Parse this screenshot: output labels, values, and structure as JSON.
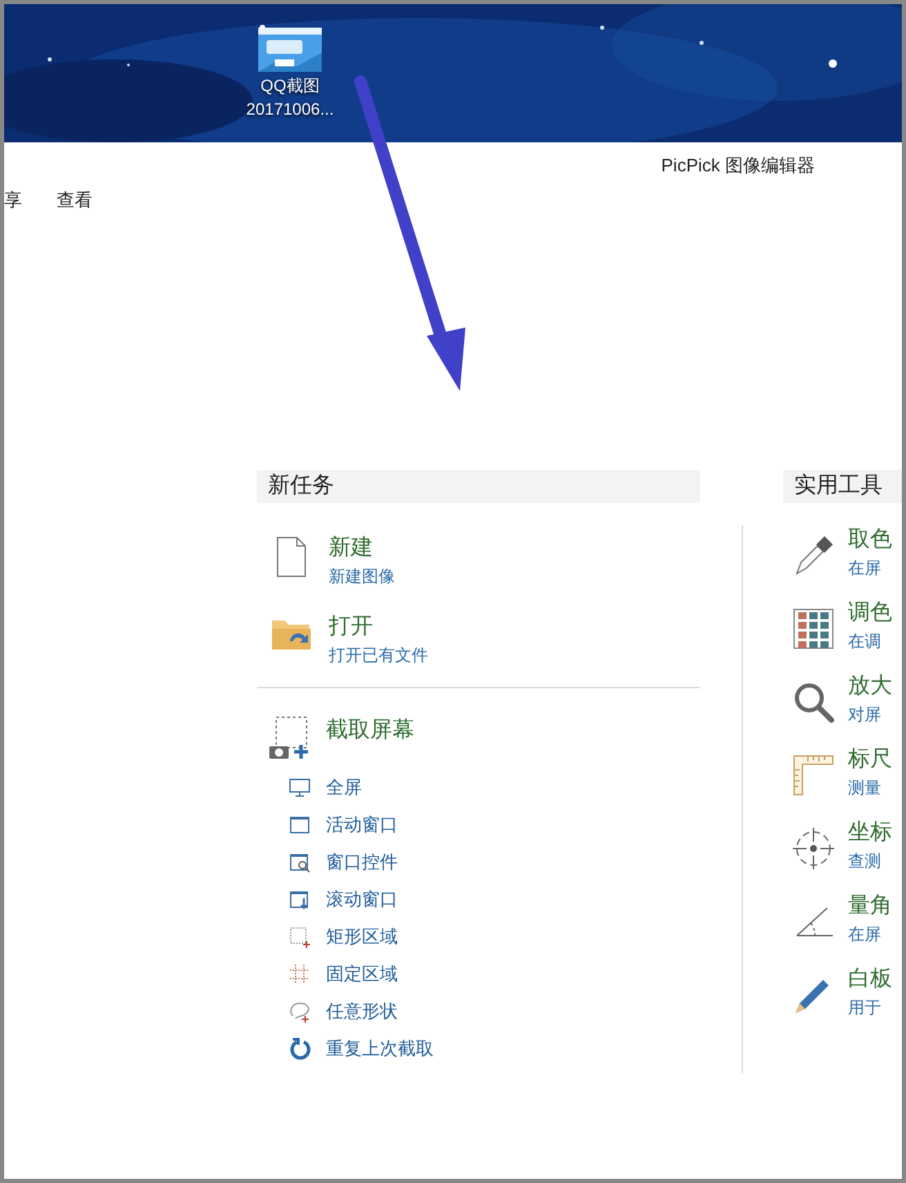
{
  "desktop": {
    "icon_label": "QQ截图\n20171006..."
  },
  "app": {
    "title": "PicPick 图像编辑器",
    "menu": [
      "享",
      "查看"
    ]
  },
  "new_task": {
    "title": "新任务",
    "items": [
      {
        "kind": "new",
        "title": "新建",
        "subtitle": "新建图像"
      },
      {
        "kind": "open",
        "title": "打开",
        "subtitle": "打开已有文件"
      }
    ],
    "capture": {
      "title": "截取屏幕",
      "items": [
        {
          "kind": "monitor",
          "label": "全屏"
        },
        {
          "kind": "window",
          "label": "活动窗口"
        },
        {
          "kind": "control",
          "label": "窗口控件"
        },
        {
          "kind": "scroll",
          "label": "滚动窗口"
        },
        {
          "kind": "rect",
          "label": "矩形区域"
        },
        {
          "kind": "fixed",
          "label": "固定区域"
        },
        {
          "kind": "freehand",
          "label": "任意形状"
        },
        {
          "kind": "repeat",
          "label": "重复上次截取"
        }
      ]
    }
  },
  "tools": {
    "title": "实用工具",
    "items": [
      {
        "kind": "eyedropper",
        "title": "取色",
        "subtitle": "在屏"
      },
      {
        "kind": "palette",
        "title": "调色",
        "subtitle": "在调"
      },
      {
        "kind": "magnifier",
        "title": "放大",
        "subtitle": "对屏"
      },
      {
        "kind": "ruler",
        "title": "标尺",
        "subtitle": "测量"
      },
      {
        "kind": "crosshair",
        "title": "坐标",
        "subtitle": "查测"
      },
      {
        "kind": "protractor",
        "title": "量角",
        "subtitle": "在屏"
      },
      {
        "kind": "pen",
        "title": "白板",
        "subtitle": "用于"
      }
    ]
  }
}
